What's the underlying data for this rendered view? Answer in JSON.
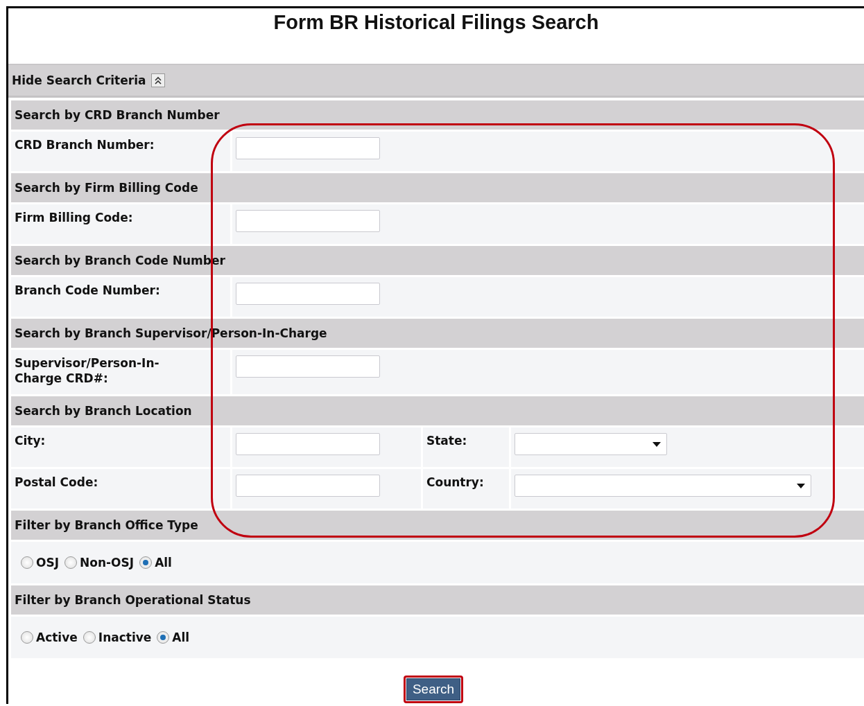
{
  "title": "Form BR Historical Filings Search",
  "toggle": {
    "label": "Hide Search Criteria",
    "expanded": true
  },
  "sections": [
    {
      "heading": "Search by CRD Branch Number",
      "kind": "fields",
      "rows": [
        {
          "cells": [
            {
              "label": "CRD Branch Number:",
              "kind": "text"
            }
          ]
        }
      ]
    },
    {
      "heading": "Search by Firm Billing Code",
      "kind": "fields",
      "rows": [
        {
          "cells": [
            {
              "label": "Firm Billing Code:",
              "kind": "text"
            }
          ]
        }
      ]
    },
    {
      "heading": "Search by Branch Code Number",
      "kind": "fields",
      "rows": [
        {
          "cells": [
            {
              "label": "Branch Code Number:",
              "kind": "text"
            }
          ]
        }
      ]
    },
    {
      "heading": "Search by Branch Supervisor/Person-In-Charge",
      "kind": "fields",
      "rows": [
        {
          "cells": [
            {
              "label": "Supervisor/Person-In-Charge CRD#:",
              "kind": "text"
            }
          ]
        }
      ]
    },
    {
      "heading": "Search by Branch Location",
      "kind": "fields",
      "rows": [
        {
          "cells": [
            {
              "label": "City:",
              "kind": "text"
            },
            {
              "label": "State:",
              "kind": "select"
            }
          ]
        },
        {
          "cells": [
            {
              "label": "Postal Code:",
              "kind": "text"
            },
            {
              "label": "Country:",
              "kind": "select"
            }
          ]
        }
      ]
    },
    {
      "heading": "Filter by Branch Office Type",
      "kind": "radios",
      "options": [
        {
          "label": "OSJ",
          "selected": false
        },
        {
          "label": "Non-OSJ",
          "selected": false
        },
        {
          "label": "All",
          "selected": true
        }
      ]
    },
    {
      "heading": "Filter by Branch Operational Status",
      "kind": "radios",
      "options": [
        {
          "label": "Active",
          "selected": false
        },
        {
          "label": "Inactive",
          "selected": false
        },
        {
          "label": "All",
          "selected": true
        }
      ]
    }
  ],
  "button": "Search"
}
